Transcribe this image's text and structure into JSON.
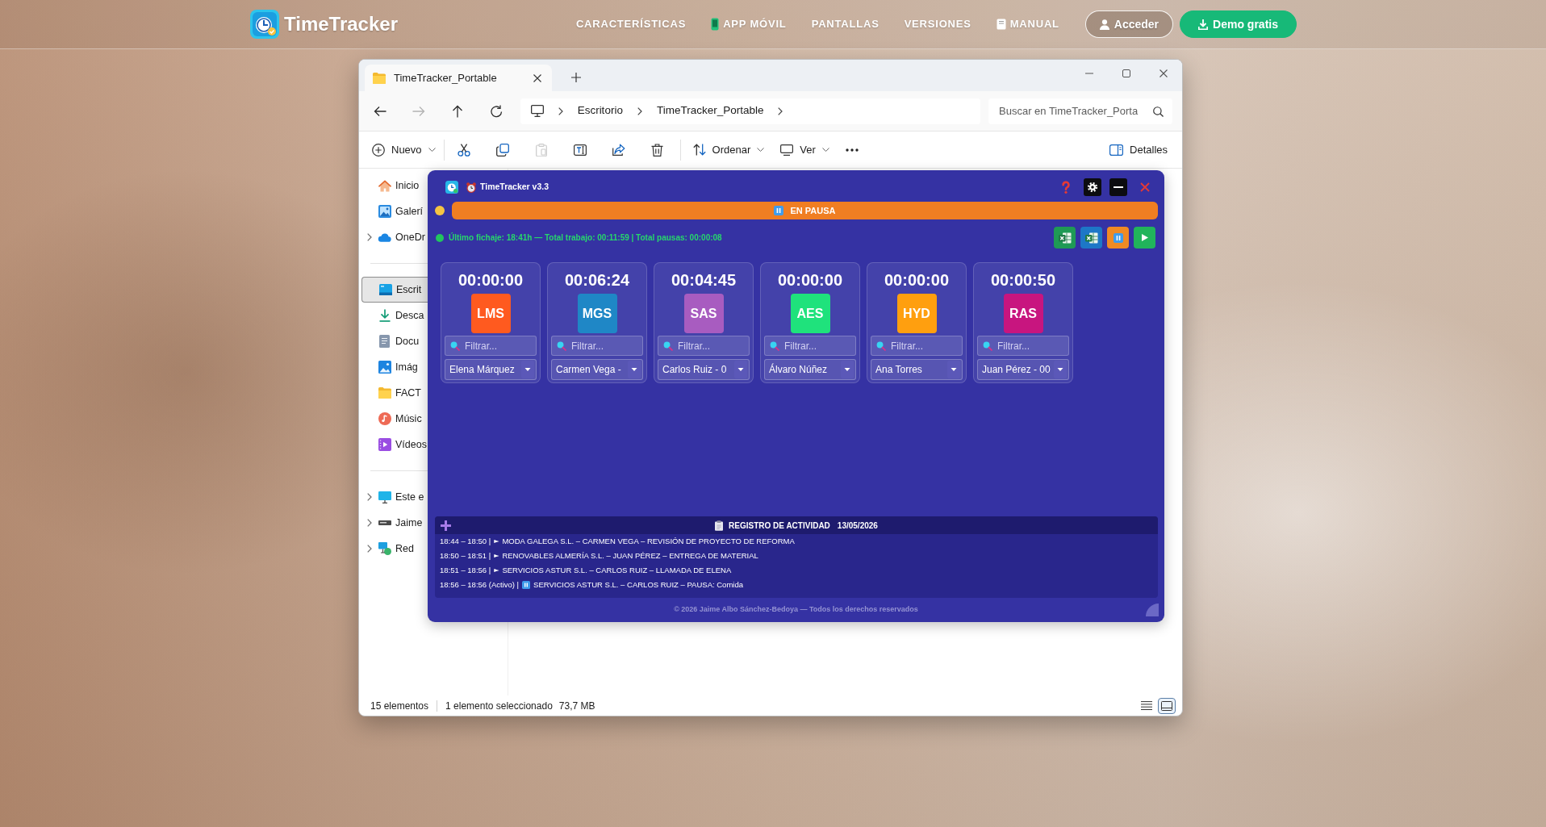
{
  "site_header": {
    "brand": "TimeTracker",
    "links": [
      {
        "kind": "plain",
        "label": "CARACTERÍSTICAS"
      },
      {
        "kind": "phone",
        "label": "APP MÓVIL"
      },
      {
        "kind": "plain",
        "label": "PANTALLAS"
      },
      {
        "kind": "plain",
        "label": "VERSIONES"
      },
      {
        "kind": "book",
        "label": "MANUAL"
      }
    ],
    "login_button": "Acceder",
    "demo_button": "Demo gratis"
  },
  "explorer": {
    "tabs": [
      {
        "label": "TimeTracker_Portable",
        "selected": true
      }
    ],
    "nav_buttons": [
      {
        "kind": "back",
        "disabled": false
      },
      {
        "kind": "forward",
        "disabled": true
      },
      {
        "kind": "up",
        "disabled": false
      },
      {
        "kind": "refresh",
        "disabled": false
      }
    ],
    "breadcrumb": [
      "Escritorio",
      "TimeTracker_Portable"
    ],
    "search": {
      "placeholder": "Buscar en TimeTracker_Porta"
    },
    "toolbar": {
      "new_label": "Nuevo",
      "actions": [
        {
          "kind": "cut",
          "disabled": false
        },
        {
          "kind": "copy",
          "disabled": false
        },
        {
          "kind": "paste",
          "disabled": true
        },
        {
          "kind": "rename",
          "disabled": false
        },
        {
          "kind": "share",
          "disabled": false
        },
        {
          "kind": "delete",
          "disabled": false
        }
      ],
      "sort_label": "Ordenar",
      "view_label": "Ver",
      "details_label": "Detalles"
    },
    "sidebar": {
      "groups": [
        [
          {
            "kind": "home",
            "label": "Inicio",
            "expandable": false,
            "selected": false
          },
          {
            "kind": "gallery",
            "label": "Galerí",
            "expandable": false,
            "selected": false
          },
          {
            "kind": "cloud",
            "label": "OneDr",
            "expandable": true,
            "selected": false
          }
        ],
        [
          {
            "kind": "desktop",
            "label": "Escrit",
            "expandable": false,
            "selected": true
          },
          {
            "kind": "downloads",
            "label": "Desca",
            "expandable": false,
            "selected": false
          },
          {
            "kind": "documents",
            "label": "Docu",
            "expandable": false,
            "selected": false
          },
          {
            "kind": "pictures",
            "label": "Imág",
            "expandable": false,
            "selected": false
          },
          {
            "kind": "folder",
            "label": "FACT",
            "expandable": false,
            "selected": false
          },
          {
            "kind": "music",
            "label": "Músic",
            "expandable": false,
            "selected": false
          },
          {
            "kind": "videos",
            "label": "Vídeos",
            "expandable": false,
            "selected": false
          }
        ],
        [
          {
            "kind": "pc",
            "label": "Este e",
            "expandable": true,
            "selected": false
          },
          {
            "kind": "drive",
            "label": "Jaime",
            "expandable": true,
            "selected": false
          },
          {
            "kind": "network",
            "label": "Red",
            "expandable": true,
            "selected": false
          }
        ]
      ]
    },
    "status_bar": {
      "item_count": "15 elementos",
      "selection": "1 elemento seleccionado",
      "selection_size": "73,7 MB",
      "views": [
        {
          "kind": "details",
          "selected": false
        },
        {
          "kind": "tiles",
          "selected": true
        }
      ]
    }
  },
  "app": {
    "title": "TimeTracker v3.3",
    "status": {
      "paused": true,
      "label": "EN PAUSA"
    },
    "summary": "Último fichaje: 18:41h — Total trabajo: 00:11:59 | Total pausas: 00:00:08",
    "actions": [
      {
        "kind": "excel"
      },
      {
        "kind": "excel-alt"
      },
      {
        "kind": "pause"
      },
      {
        "kind": "play"
      }
    ],
    "workers": [
      {
        "time": "00:00:00",
        "initials": "LMS",
        "color": "#ff5a1f",
        "filter_placeholder": "Filtrar...",
        "employee": "Elena Márquez"
      },
      {
        "time": "00:06:24",
        "initials": "MGS",
        "color": "#1f87c6",
        "filter_placeholder": "Filtrar...",
        "employee": "Carmen Vega -"
      },
      {
        "time": "00:04:45",
        "initials": "SAS",
        "color": "#a85cc0",
        "filter_placeholder": "Filtrar...",
        "employee": "Carlos Ruiz - 0"
      },
      {
        "time": "00:00:00",
        "initials": "AES",
        "color": "#1fe27c",
        "filter_placeholder": "Filtrar...",
        "employee": "Álvaro Núñez"
      },
      {
        "time": "00:00:00",
        "initials": "HYD",
        "color": "#ff9f0f",
        "filter_placeholder": "Filtrar...",
        "employee": "Ana Torres"
      },
      {
        "time": "00:00:50",
        "initials": "RAS",
        "color": "#c8157f",
        "filter_placeholder": "Filtrar...",
        "employee": "Juan Pérez - 00"
      }
    ],
    "activity_log": {
      "title": "REGISTRO DE ACTIVIDAD",
      "date": "13/05/2026",
      "entries": [
        {
          "kind": "task",
          "time": "18:44 – 18:50 |",
          "marker": "►",
          "text": "MODA GALEGA S.L. – CARMEN VEGA – REVISIÓN DE PROYECTO DE REFORMA"
        },
        {
          "kind": "task",
          "time": "18:50 – 18:51 |",
          "marker": "►",
          "text": "RENOVABLES ALMERÍA S.L. – JUAN PÉREZ – ENTREGA DE MATERIAL"
        },
        {
          "kind": "task",
          "time": "18:51 – 18:56 |",
          "marker": "►",
          "text": "SERVICIOS ASTUR S.L. – CARLOS RUIZ – LLAMADA DE ELENA"
        },
        {
          "kind": "pause",
          "time": "18:56 – 18:56 (Activo) |",
          "text": "SERVICIOS ASTUR S.L. – CARLOS RUIZ – PAUSA: Comida"
        }
      ]
    },
    "footer": "© 2026 Jaime Albo Sánchez-Bedoya — Todos los derechos reservados"
  }
}
